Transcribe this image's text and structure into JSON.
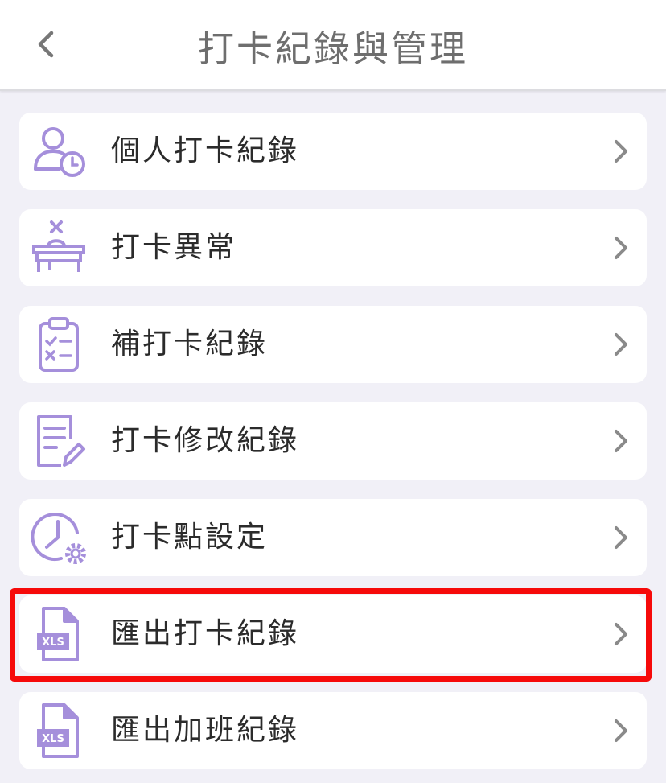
{
  "header": {
    "title": "打卡紀錄與管理",
    "back_icon": "chevron-left-icon"
  },
  "colors": {
    "accent": "#a58fdb",
    "highlight": "#f60a0a",
    "background": "#f1f0f7"
  },
  "items": [
    {
      "label": "個人打卡紀錄",
      "icon": "user-clock-icon"
    },
    {
      "label": "打卡異常",
      "icon": "desk-x-icon"
    },
    {
      "label": "補打卡紀錄",
      "icon": "clipboard-checklist-icon"
    },
    {
      "label": "打卡修改紀錄",
      "icon": "document-edit-icon"
    },
    {
      "label": "打卡點設定",
      "icon": "clock-gear-icon"
    },
    {
      "label": "匯出打卡紀錄",
      "icon": "xls-file-icon",
      "highlighted": true
    },
    {
      "label": "匯出加班紀錄",
      "icon": "xls-file-icon"
    }
  ],
  "xls_badge": "XLS"
}
